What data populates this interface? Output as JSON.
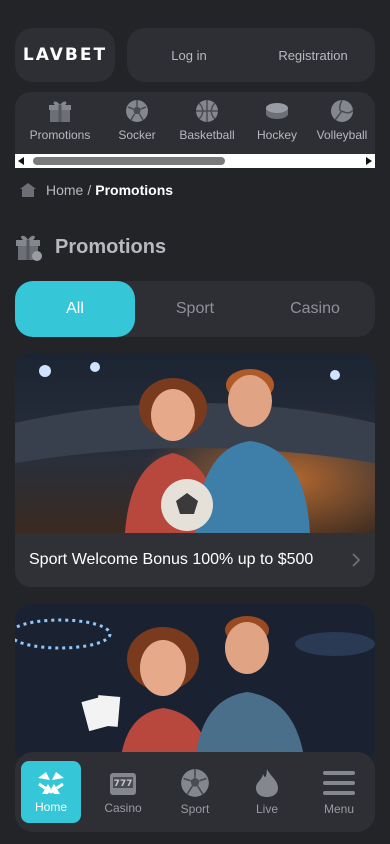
{
  "header": {
    "logo": "LAVBET",
    "login_label": "Log in",
    "registration_label": "Registration"
  },
  "sports": [
    {
      "label": "Promotions",
      "icon": "gift-icon"
    },
    {
      "label": "Socker",
      "icon": "soccer-ball-icon"
    },
    {
      "label": "Basketball",
      "icon": "basketball-icon"
    },
    {
      "label": "Hockey",
      "icon": "hockey-puck-icon"
    },
    {
      "label": "Volleyball",
      "icon": "volleyball-icon"
    }
  ],
  "breadcrumb": {
    "home_label": "Home",
    "separator": "/",
    "current_label": "Promotions"
  },
  "page": {
    "title": "Promotions"
  },
  "tabs": [
    {
      "label": "All",
      "active": true
    },
    {
      "label": "Sport",
      "active": false
    },
    {
      "label": "Casino",
      "active": false
    }
  ],
  "promos": [
    {
      "caption": "Sport Welcome Bonus 100% up to $500"
    },
    {
      "caption": ""
    }
  ],
  "bottom_nav": [
    {
      "label": "Home",
      "icon": "home-icon",
      "active": true
    },
    {
      "label": "Casino",
      "icon": "slot-machine-icon",
      "active": false
    },
    {
      "label": "Sport",
      "icon": "soccer-ball-icon",
      "active": false
    },
    {
      "label": "Live",
      "icon": "flame-icon",
      "active": false
    },
    {
      "label": "Menu",
      "icon": "hamburger-menu-icon",
      "active": false
    }
  ],
  "colors": {
    "accent": "#35c6d8",
    "background": "#232428",
    "panel": "#2d2f34"
  }
}
